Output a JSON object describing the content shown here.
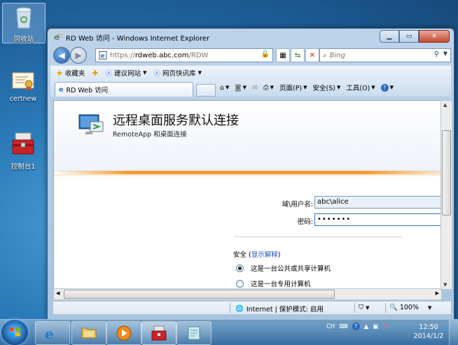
{
  "desktop": {
    "icons": [
      {
        "label": "回收站"
      },
      {
        "label": "certnew"
      },
      {
        "label": "控制台1"
      }
    ]
  },
  "window": {
    "title": "RD Web 访问 - Windows Internet Explorer",
    "address": {
      "scheme": "https://",
      "host": "rdweb.abc.com",
      "path": "/RDW"
    },
    "search_placeholder": "Bing",
    "favorites": {
      "favorites_label": "收藏夹",
      "suggested_sites": "建议网站",
      "web_slice_gallery": "网页快讯库"
    },
    "tab_title": "RD Web 访问",
    "commands": {
      "page": "页面(P)",
      "safety": "安全(S)",
      "tools": "工具(O)"
    },
    "status": {
      "zone": "Internet | 保护模式: 启用",
      "zoom": "100%"
    }
  },
  "page": {
    "title": "远程桌面服务默认连接",
    "subtitle": "RemoteApp 和桌面连接",
    "domain_user_label": "域\\用户名:",
    "domain_user_value": "abc\\alice",
    "password_label": "密码:",
    "password_value": "•••••••",
    "security_label": "安全",
    "security_link": "显示解释",
    "options": [
      "这是一台公共或共享计算机",
      "这是一台专用计算机"
    ],
    "selected_option": 0
  },
  "taskbar": {
    "tray_lang": "CH",
    "clock_time": "12:50",
    "clock_date": "2014/1/2"
  },
  "colors": {
    "accent_orange": "#f39a2c",
    "link_blue": "#1a55b8",
    "window_frame": "#bcd3ea"
  }
}
